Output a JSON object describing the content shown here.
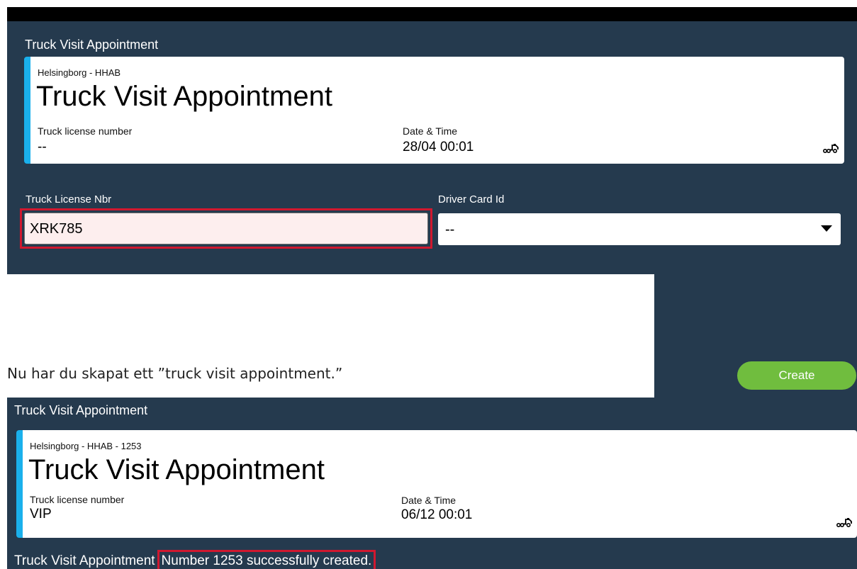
{
  "top_form": {
    "panel_title": "Truck Visit Appointment",
    "card": {
      "subtitle": "Helsingborg - HHAB",
      "title": "Truck Visit Appointment",
      "license_label": "Truck license number",
      "license_value": "--",
      "date_label": "Date & Time",
      "date_value": "28/04 00:01",
      "icon": "truck-icon"
    },
    "fields": {
      "truck_license_label": "Truck License Nbr",
      "truck_license_value": "XRK785",
      "driver_card_label": "Driver Card Id",
      "driver_card_value": "--"
    }
  },
  "note": "Nu har du skapat ett ”truck visit appointment.”",
  "create_button": "Create",
  "bottom_result": {
    "panel_title": "Truck Visit Appointment",
    "card": {
      "subtitle": "Helsingborg - HHAB - 1253",
      "title": "Truck Visit Appointment",
      "license_label": "Truck license number",
      "license_value": "VIP",
      "date_label": "Date & Time",
      "date_value": "06/12 00:01",
      "icon": "truck-icon"
    },
    "message_prefix": "Truck Visit Appointment",
    "message_highlight": "Number 1253 successfully created."
  },
  "colors": {
    "panel": "#253a4e",
    "accent": "#1ab0ec",
    "highlight_border": "#d0182f",
    "create_button": "#70bd3e"
  }
}
